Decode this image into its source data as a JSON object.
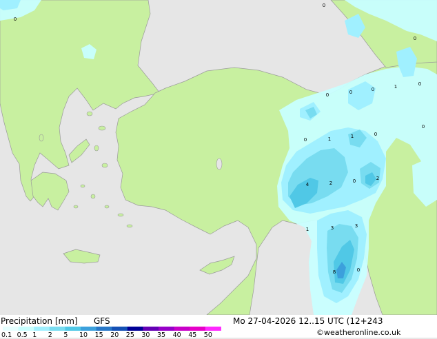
{
  "footer": {
    "title": "Precipitation [mm]",
    "model": "GFS",
    "datetime": "Mo 27-04-2026 12..15 UTC (12+243",
    "credit": "©weatheronline.co.uk"
  },
  "legend": {
    "values": [
      "0.1",
      "0.5",
      "1",
      "2",
      "5",
      "10",
      "15",
      "20",
      "25",
      "30",
      "35",
      "40",
      "45",
      "50"
    ],
    "colors": [
      "#e6ffff",
      "#c8ffff",
      "#a0f0ff",
      "#78dcf0",
      "#50c8e6",
      "#3ca0dc",
      "#2878c8",
      "#1450b4",
      "#000096",
      "#6400b4",
      "#9600c8",
      "#c800c8",
      "#e600c8",
      "#ff28ff"
    ]
  },
  "map_colors": {
    "sea": "#e6e6e6",
    "land": "#c8f0a0",
    "border": "#a0a0a0"
  },
  "map_values": [
    {
      "text": "0"
    },
    {
      "text": "0"
    },
    {
      "text": "0"
    },
    {
      "text": "1"
    },
    {
      "text": "0"
    },
    {
      "text": "0"
    },
    {
      "text": "0"
    },
    {
      "text": "0"
    },
    {
      "text": "0"
    },
    {
      "text": "1"
    },
    {
      "text": "1"
    },
    {
      "text": "0"
    },
    {
      "text": "0"
    },
    {
      "text": "4"
    },
    {
      "text": "2"
    },
    {
      "text": "0"
    },
    {
      "text": "2"
    },
    {
      "text": "1"
    },
    {
      "text": "3"
    },
    {
      "text": "3"
    },
    {
      "text": "8"
    },
    {
      "text": "0"
    }
  ]
}
